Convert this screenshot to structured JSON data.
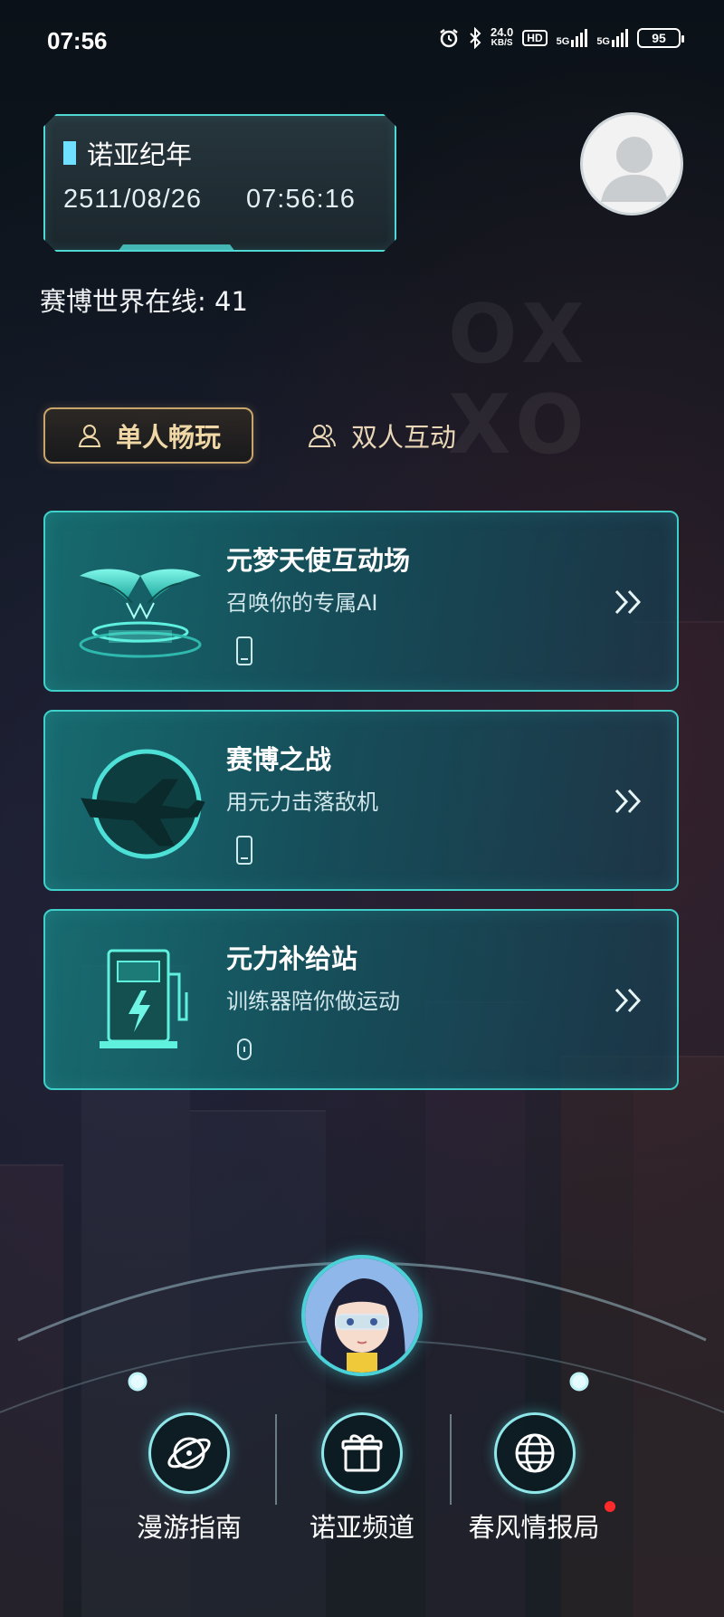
{
  "status_bar": {
    "time": "07:56",
    "net_speed_value": "24.0",
    "net_speed_unit": "KB/S",
    "hd_label": "HD",
    "signal_1": "5G",
    "signal_2": "5G",
    "battery": "95"
  },
  "date_panel": {
    "title": "诺亚纪年",
    "date": "2511/08/26",
    "time": "07:56:16"
  },
  "online_count_text": "赛博世界在线: 41",
  "mode_tabs": {
    "single": "单人畅玩",
    "duo": "双人互动"
  },
  "cards": [
    {
      "title": "元梦天使互动场",
      "subtitle": "召唤你的专属AI",
      "icon": "winged-pedestal-icon",
      "device_icon": "phone-icon"
    },
    {
      "title": "赛博之战",
      "subtitle": "用元力击落敌机",
      "icon": "plane-icon",
      "device_icon": "phone-icon"
    },
    {
      "title": "元力补给站",
      "subtitle": "训练器陪你做运动",
      "icon": "charging-station-icon",
      "device_icon": "wearable-icon"
    }
  ],
  "bottom_nav": [
    {
      "label": "漫游指南",
      "icon": "planet-icon"
    },
    {
      "label": "诺亚频道",
      "icon": "gift-icon"
    },
    {
      "label": "春风情报局",
      "icon": "globe-icon",
      "badge": "red-dot"
    }
  ],
  "colors": {
    "accent_cyan": "#4fd8d4",
    "gold": "#c9a56c",
    "notification_red": "#ff2a2a"
  }
}
